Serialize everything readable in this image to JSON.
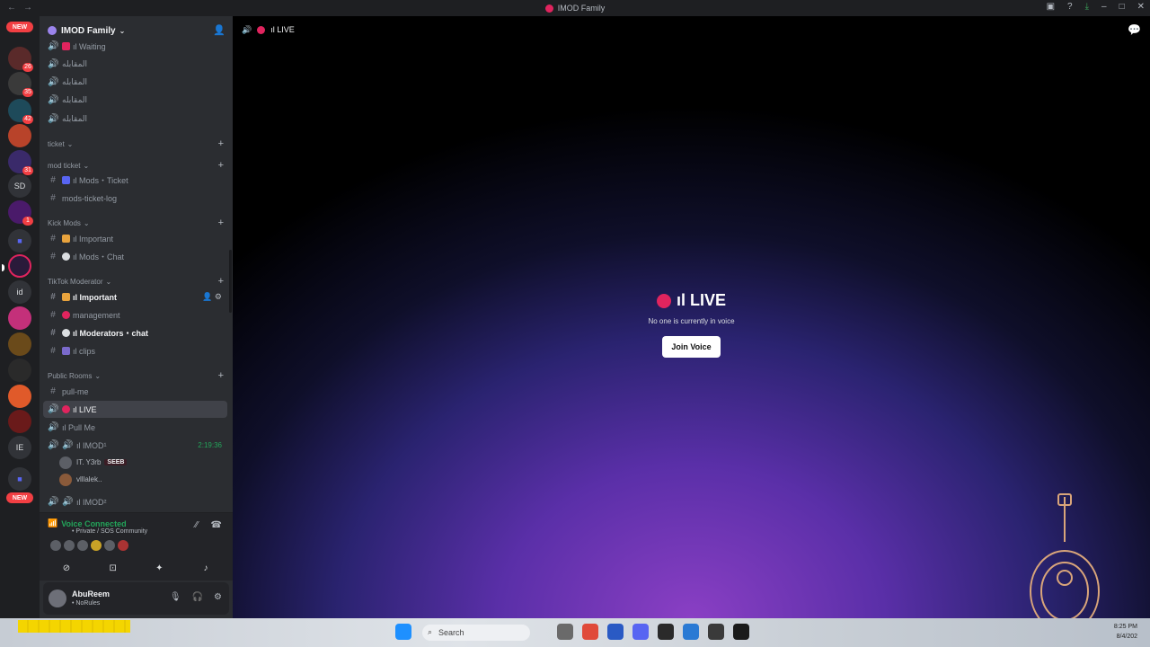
{
  "window": {
    "title": "IMOD Family",
    "back": "←",
    "forward": "→"
  },
  "servers": {
    "new_top": "NEW",
    "new_bottom": "NEW",
    "sd": "SD",
    "id": "id",
    "ie": "IE",
    "badges": [
      "26",
      "35",
      "42",
      "31",
      "1"
    ]
  },
  "guild": {
    "name": "IMOD Family"
  },
  "channels": {
    "waiting": "ıl Waiting",
    "voice_ar": [
      "المقابله",
      "المقابله",
      "المقابله",
      "المقابله"
    ],
    "cat_ticket": "ticket",
    "cat_mod_ticket": "mod ticket",
    "mods_ticket": "ıl Mods・Ticket",
    "mods_ticket_log": "mods-ticket-log",
    "cat_kick_mods": "Kick Mods",
    "kick_important": "ıl Important",
    "kick_mods_chat": "ıl Mods・Chat",
    "cat_tiktok": "TikTok Moderator",
    "tiktok_important": "ıl Important",
    "management": "management",
    "moderators_chat": "ıl Moderators・chat",
    "clips": "ıl clips",
    "cat_public": "Public Rooms",
    "pull_me_text": "pull-me",
    "live": "ıl LIVE",
    "pull_me_voice": "ıl Pull Me",
    "imod1": "ıl IMOD¹",
    "imod1_time": "2:19:36",
    "user1": "IT. Y3rb",
    "user1_tag": "SEEB",
    "user2": "vlllalek..",
    "imod2": "ıl IMOD²"
  },
  "voice_panel": {
    "status": "Voice Connected",
    "location": "• Private / SOS Community"
  },
  "user": {
    "name": "AbuReem",
    "status": "• NoRules"
  },
  "main": {
    "header": "ıl LIVE",
    "live_title": "ıl LIVE",
    "empty_text": "No one is currently in voice",
    "join_label": "Join Voice"
  },
  "taskbar": {
    "search_placeholder": "Search",
    "time": "8:25 PM",
    "date": "8/4/202"
  }
}
